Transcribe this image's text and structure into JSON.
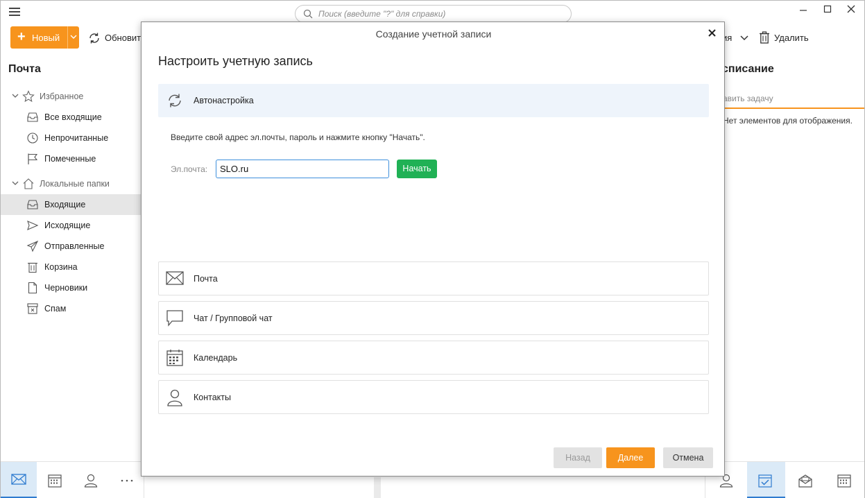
{
  "search": {
    "placeholder": "Поиск (введите \"?\" для справки)"
  },
  "toolbar": {
    "new_label": "Новый",
    "refresh_label": "Обновить",
    "actions_partial_label": "ия",
    "delete_label": "Удалить"
  },
  "left_panel": {
    "title": "Почта",
    "favorites": {
      "label": "Избранное",
      "items": [
        {
          "label": "Все входящие",
          "icon": "inbox-stack-icon"
        },
        {
          "label": "Непрочитанные",
          "icon": "clock-icon"
        },
        {
          "label": "Помеченные",
          "icon": "flag-icon"
        }
      ]
    },
    "local": {
      "label": "Локальные папки",
      "items": [
        {
          "label": "Входящие",
          "icon": "inbox-icon",
          "active": true
        },
        {
          "label": "Исходящие",
          "icon": "outbox-icon"
        },
        {
          "label": "Отправленные",
          "icon": "sent-icon"
        },
        {
          "label": "Корзина",
          "icon": "trash-icon"
        },
        {
          "label": "Черновики",
          "icon": "draft-icon"
        },
        {
          "label": "Спам",
          "icon": "spam-icon"
        }
      ]
    }
  },
  "right_panel": {
    "title": "списание",
    "add_task": "авить задачу",
    "empty": "Нет элементов для отображения."
  },
  "modal": {
    "title": "Создание учетной записи",
    "heading": "Настроить учетную запись",
    "auto_label": "Автонастройка",
    "instructions": "Введите свой адрес эл.почты, пароль и нажмите кнопку \"Начать\".",
    "email_label": "Эл.почта:",
    "email_value": "SLO.ru",
    "start_label": "Начать",
    "account_types": [
      {
        "label": "Почта",
        "icon": "envelope-icon"
      },
      {
        "label": "Чат / Групповой чат",
        "icon": "chat-bubble-icon"
      },
      {
        "label": "Календарь",
        "icon": "calendar-icon"
      },
      {
        "label": "Контакты",
        "icon": "person-icon"
      }
    ],
    "back_label": "Назад",
    "next_label": "Далее",
    "cancel_label": "Отмена"
  },
  "colors": {
    "accent": "#f7941d",
    "start_green": "#20b155",
    "focus_blue": "#3d8fdc",
    "active_tab": "#dbeaf7"
  }
}
